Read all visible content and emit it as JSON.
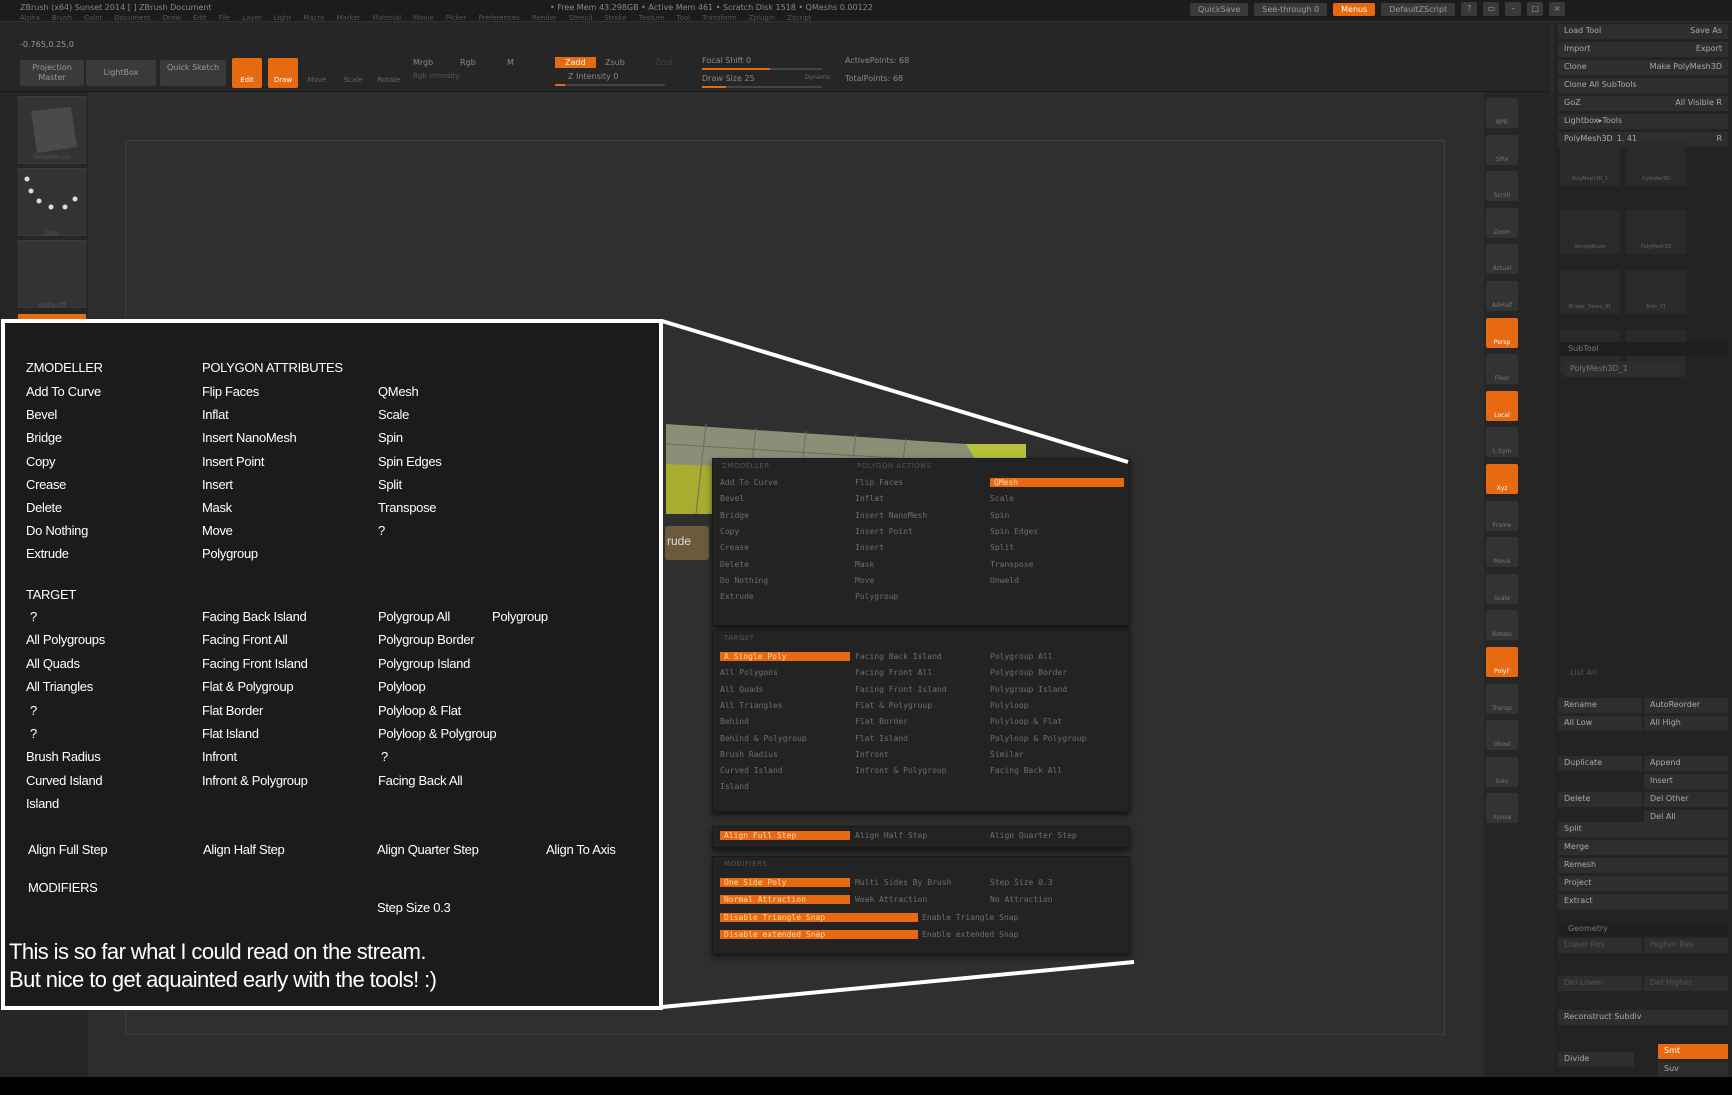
{
  "window": {
    "title": "ZBrush (x64) Sunset 2014 [   ]     ZBrush Document",
    "memory": "• Free Mem 43.298GB • Active Mem 461 • Scratch Disk 1518 • QMeshs 0.00122",
    "menus": [
      "Alpha",
      "Brush",
      "Color",
      "Document",
      "Draw",
      "Edit",
      "File",
      "Layer",
      "Light",
      "Macro",
      "Marker",
      "Material",
      "Movie",
      "Picker",
      "Preferences",
      "Render",
      "Stencil",
      "Stroke",
      "Texture",
      "Tool",
      "Transform",
      "Zplugin",
      "Zscript"
    ],
    "quicksave": "QuickSave",
    "seethrough": "See-through 0",
    "menus_btn": "Menus",
    "script": "DefaultZScript"
  },
  "toolbar": {
    "coord": "-0.765,0.25,0",
    "projection_master": "Projection Master",
    "lightbox": "LightBox",
    "quick_sketch": "Quick Sketch",
    "edit": "Edit",
    "draw": "Draw",
    "move": "Move",
    "scale": "Scale",
    "rotate": "Rotate",
    "mrgb": "Mrgb",
    "rgb": "Rgb",
    "m": "M",
    "rgb_intensity": "Rgb Intensity",
    "zadd": "Zadd",
    "zsub": "Zsub",
    "zcut": "Zcut",
    "z_intensity": "Z Intensity 0",
    "focal_shift": "Focal Shift 0",
    "draw_size": "Draw Size 25",
    "dynamic": "Dynamic",
    "active_points": "ActivePoints: 68",
    "total_points": "TotalPoints: 68"
  },
  "left_shelf": [
    "SimpleBrush",
    "Dots",
    "Alpha Off"
  ],
  "right_rail": [
    "BPR",
    "SPix",
    "Scroll",
    "Zoom",
    "Actual",
    "AAHalf",
    "Persp",
    "Floor",
    "Local",
    "L.Sym",
    "Xyz",
    "Frame",
    "Move",
    "Scale",
    "Rotate",
    "PolyF",
    "Transp",
    "Ghost",
    "Solo",
    "Xpose"
  ],
  "right_panel": {
    "rows": [
      [
        "Load Tool",
        "Save As"
      ],
      [
        "Import",
        "Export"
      ],
      [
        "Clone",
        "Make PolyMesh3D"
      ],
      [
        "Clone All SubTools",
        ""
      ],
      [
        "GoZ",
        "All  Visible  R"
      ],
      [
        "Lightbox▸Tools",
        ""
      ],
      [
        "PolyMesh3D_1. 41",
        "R"
      ]
    ],
    "tools": [
      "PolyMesh3D_1",
      "Cylinder3D",
      "SimpleBrush",
      "PolyMesh3D",
      "Bridge_Demo_01",
      "Arko_01",
      "Bridge_Parts_01",
      "PolyMesh3D_1"
    ],
    "subtool_header": "SubTool",
    "subtool_item": "PolyMesh3D_1",
    "list_all": "List All",
    "rename": "Rename",
    "autoreorder": "AutoReorder",
    "all_low": "All Low",
    "all_high": "All High",
    "duplicate": "Duplicate",
    "append": "Append",
    "insert": "Insert",
    "delete": "Delete",
    "del_other": "Del Other",
    "del_all": "Del All",
    "split": "Split",
    "merge": "Merge",
    "remesh": "Remesh",
    "project": "Project",
    "extract": "Extract",
    "geometry_header": "Geometry",
    "lower_res": "Lower Res",
    "higher_res": "Higher Res",
    "del_lower": "Del Lower",
    "del_higher": "Del Higher",
    "reconstruct": "Reconstruct Subdiv",
    "divide": "Divide",
    "smt": "Smt",
    "suv": "Suv"
  },
  "zoom_menu": {
    "zmodeller_head": "ZMODELLER",
    "polygon_actions_head": "POLYGON ACTIONS",
    "col1": [
      "Add To Curve",
      "Bevel",
      "Bridge",
      "Copy",
      "Crease",
      "Delete",
      "Do Nothing",
      "Extrude"
    ],
    "col2": [
      "Flip Faces",
      "Inflat",
      "Insert NanoMesh",
      "Insert Point",
      "Insert",
      "Mask",
      "Move",
      "Polygroup"
    ],
    "col3": [
      "QMesh",
      "Scale",
      "Spin",
      "Spin Edges",
      "Split",
      "Transpose",
      "Unweld"
    ],
    "target_head": "TARGET",
    "t1": [
      "A Single Poly",
      "All Polygons",
      "All Quads",
      "All Triangles",
      "Behind",
      "Behind & Polygroup",
      "Brush Radius",
      "Curved Island",
      "Island"
    ],
    "t2": [
      "Facing Back Island",
      "Facing Front All",
      "Facing Front Island",
      "Flat & Polygroup",
      "Flat Border",
      "Flat Island",
      "Infront",
      "Infront & Polygroup"
    ],
    "t3": [
      "Polygroup All",
      "Polygroup Border",
      "Polygroup Island",
      "Polyloop",
      "Polyloop & Flat",
      "Polyloop & Polygroup",
      "Similar",
      "Facing Back All"
    ],
    "align": [
      "Align Full Step",
      "Align Half Step",
      "Align Quarter Step"
    ],
    "modifiers_head": "MODIFIERS",
    "m1": [
      "One Side Poly",
      "Normal Attraction",
      "Disable Triangle Snap",
      "Disable extended Snap"
    ],
    "m2": [
      "Multi Sides By Brush",
      "Weak Attraction",
      "Enable Triangle Snap",
      "Enable extended Snap"
    ],
    "m3": [
      "Step Size 0.3",
      "No Attraction"
    ],
    "extrude_tag": "rude"
  },
  "notes": {
    "zmodeller": "ZMODELLER",
    "polygon_attributes": "POLYGON ATTRIBUTES",
    "col1": [
      "Add To Curve",
      "Bevel",
      "Bridge",
      "Copy",
      "Crease",
      "Delete",
      "Do Nothing",
      "Extrude"
    ],
    "col2": [
      "Flip Faces",
      "Inflat",
      "Insert NanoMesh",
      "Insert Point",
      "Insert",
      "Mask",
      "Move",
      "Polygroup"
    ],
    "col3": [
      "QMesh",
      "Scale",
      "Spin",
      "Spin Edges",
      "Split",
      "Transpose",
      "?"
    ],
    "target": "TARGET",
    "t1": [
      "?",
      "All Polygroups",
      "All Quads",
      "All Triangles",
      "?",
      "?",
      "Brush Radius",
      "Curved Island",
      "Island"
    ],
    "t2": [
      "Facing Back Island",
      "Facing Front All",
      "Facing Front Island",
      "Flat & Polygroup",
      "Flat Border",
      "Flat Island",
      "Infront",
      "Infront & Polygroup"
    ],
    "t3": [
      "Polygroup All",
      "Polygroup Border",
      "Polygroup Island",
      "Polyloop",
      "Polyloop & Flat",
      "Polyloop & Polygroup",
      "?",
      "Facing Back All"
    ],
    "t4": "Polygroup",
    "align": [
      "Align Full Step",
      "Align Half Step",
      "Align Quarter Step",
      "Align To Axis"
    ],
    "modifiers": "MODIFIERS",
    "step_size": "Step Size 0.3",
    "message_line1": "This is so far what I could read on the stream.",
    "message_line2": "But nice to get aquainted early with the tools! :)"
  },
  "colors": {
    "accent": "#e86a10",
    "panel": "#232323",
    "canvas": "#2d2d2d"
  }
}
